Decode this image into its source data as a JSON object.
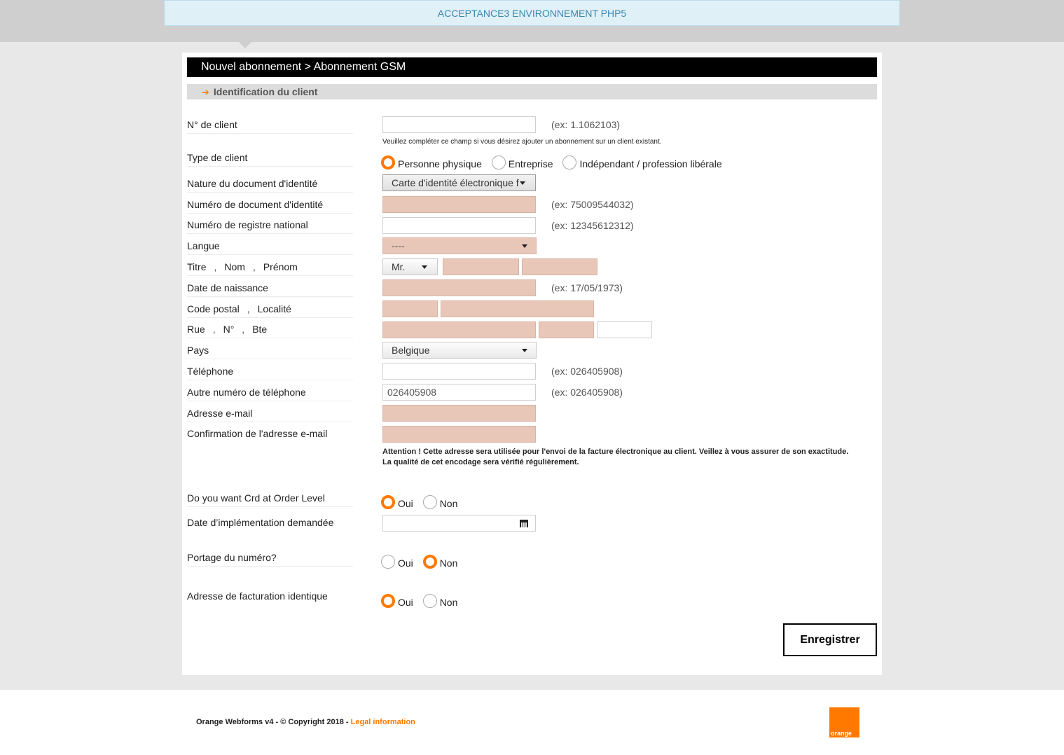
{
  "env_banner": "ACCEPTANCE3 ENVIRONNEMENT PHP5",
  "page_title": "Nouvel abonnement > Abonnement GSM",
  "section_title": "Identification du client",
  "labels": {
    "client_no": "N° de client",
    "client_type": "Type de client",
    "doc_nature": "Nature du document d'identité",
    "doc_number": "Numéro de document d'identité",
    "national_reg": "Numéro de registre national",
    "language": "Langue",
    "title": "Titre",
    "last_name": "Nom",
    "first_name": "Prénom",
    "birth_date": "Date de naissance",
    "postal_code": "Code postal",
    "locality": "Localité",
    "street": "Rue",
    "number": "N°",
    "box": "Bte",
    "country": "Pays",
    "phone": "Téléphone",
    "other_phone": "Autre numéro de téléphone",
    "email": "Adresse e-mail",
    "email_confirm": "Confirmation de l'adresse e-mail",
    "crd_order_level": "Do you want Crd at Order Level",
    "impl_date": "Date d’implémentation demandée",
    "number_porting": "Portage du numéro?",
    "billing_identical": "Adresse de facturation identique"
  },
  "separator": ",",
  "hints": {
    "client_no": "(ex: 1.1062103)",
    "doc_number": "(ex: 75009544032)",
    "national_reg": "(ex: 12345612312)",
    "birth_date": "(ex: 17/05/1973)",
    "phone": "(ex: 026405908)",
    "other_phone": "(ex: 026405908)"
  },
  "client_no_note": "Veuillez compléter ce champ si vous désirez ajouter un abonnement sur un client existant.",
  "client_type_options": [
    "Personne physique",
    "Entreprise",
    "Indépendant / profession libérale"
  ],
  "client_type_selected": "Personne physique",
  "doc_nature_value": "Carte d'identité électronique f",
  "language_value": "----",
  "title_value": "Mr.",
  "country_value": "Belgique",
  "other_phone_value": "026405908",
  "attention_text": "Attention ! Cette adresse sera utilisée pour l'envoi de la facture électronique au client. Veillez à vous assurer de son exactitude. La qualité de cet encodage sera vérifié régulièrement.",
  "yes_label": "Oui",
  "no_label": "Non",
  "crd_order_level_selected": "Oui",
  "number_porting_selected": "Non",
  "billing_identical_selected": "Oui",
  "save_label": "Enregistrer",
  "footer": {
    "text": "Orange Webforms v4 - © Copyright 2018 - ",
    "legal_link": "Legal information",
    "logo_text": "orange"
  },
  "colors": {
    "brand_orange": "#ff7900",
    "required_field": "#e8c6b8",
    "banner_bg": "#dff0f7",
    "banner_text": "#3a88b0"
  }
}
